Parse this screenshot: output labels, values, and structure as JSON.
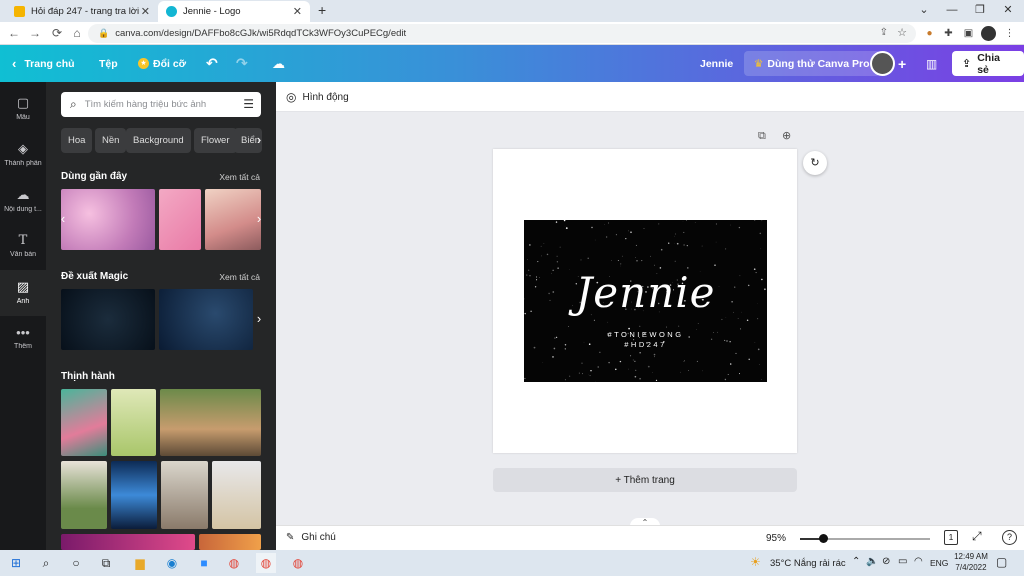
{
  "browser": {
    "tabs": [
      {
        "title": "Hỏi đáp 247 - trang tra lời",
        "close": "✕"
      },
      {
        "title": "Jennie - Logo",
        "close": "✕"
      }
    ],
    "new_tab": "+",
    "url": "canva.com/design/DAFFbo8cGJk/wi5RdqdTCk3WFOy3CuPECg/edit",
    "window_controls": [
      "⌄",
      "—",
      "❐",
      "✕"
    ]
  },
  "header": {
    "home_label": "Trang chủ",
    "file_label": "Tệp",
    "resize_label": "Đổi cỡ",
    "design_name": "Jennie",
    "pro_label": "Dùng thử Canva Pro",
    "share_label": "Chia sẻ",
    "plus": "+"
  },
  "sidebar": {
    "items": [
      {
        "label": "Mẫu",
        "icon": "template-icon"
      },
      {
        "label": "Thành phần",
        "icon": "elements-icon"
      },
      {
        "label": "Nội dung t...",
        "icon": "upload-icon"
      },
      {
        "label": "Văn bản",
        "icon": "text-icon"
      },
      {
        "label": "Ảnh",
        "icon": "photo-icon"
      },
      {
        "label": "Thêm",
        "icon": "more-icon"
      }
    ]
  },
  "panel": {
    "search_placeholder": "Tìm kiếm hàng triệu bức ảnh",
    "chips": [
      "Hoa",
      "Nền",
      "Background",
      "Flower",
      "Biển"
    ],
    "recent": {
      "title": "Dùng gần đây",
      "see_all": "Xem tất cả"
    },
    "magic": {
      "title": "Đề xuất Magic",
      "see_all": "Xem tất cả"
    },
    "trending": {
      "title": "Thịnh hành"
    }
  },
  "editor": {
    "animate_label": "Hình động",
    "add_page_label": "+ Thêm trang",
    "design_title": "Jennie",
    "design_line1": "#TONIEWONG",
    "design_line2": "#HD247"
  },
  "bottom": {
    "notes_label": "Ghi chú",
    "zoom": "95%",
    "zoom_fraction": 0.18,
    "page_count": "1",
    "help": "?"
  },
  "taskbar": {
    "weather": "35°C  Nắng rải rác",
    "lang": "ENG",
    "time": "12:49 AM",
    "date": "7/4/2022"
  },
  "colors": {
    "header_start": "#10bfd3",
    "header_end": "#7b3fe4",
    "sidebar_bg": "#18191b",
    "panel_bg": "#252627"
  }
}
